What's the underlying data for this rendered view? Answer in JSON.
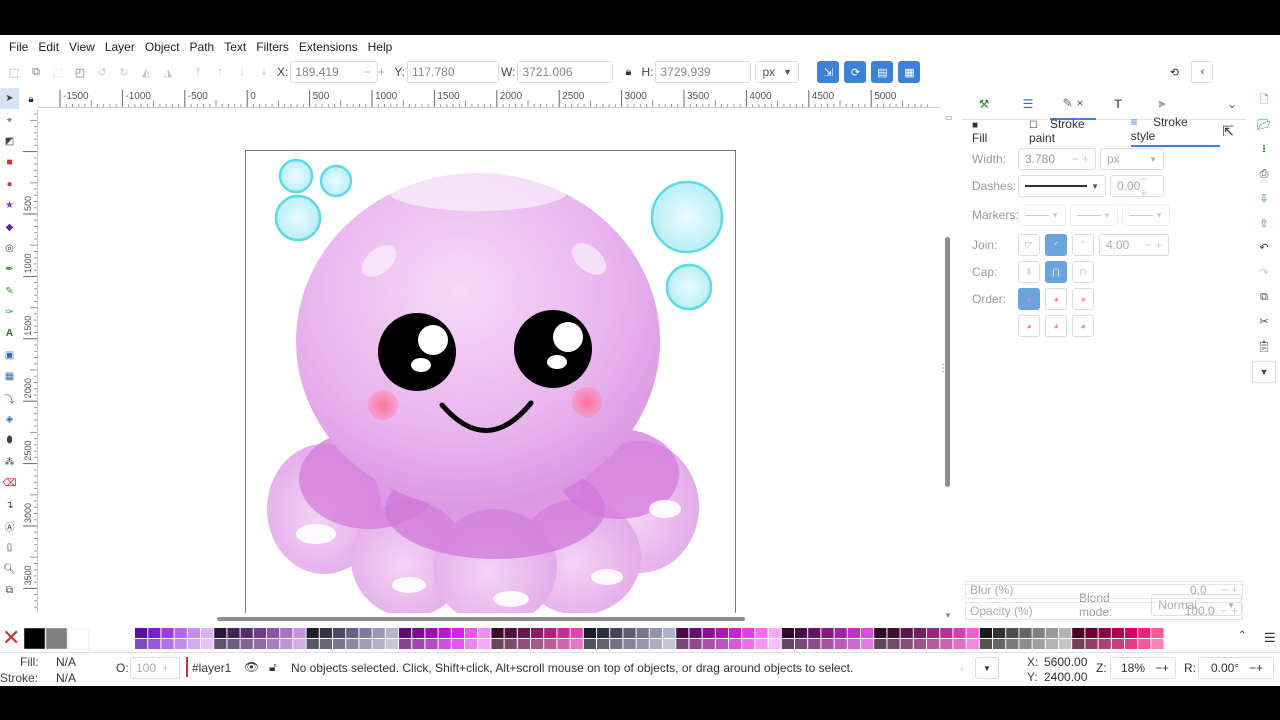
{
  "menu": [
    "File",
    "Edit",
    "View",
    "Layer",
    "Object",
    "Path",
    "Text",
    "Filters",
    "Extensions",
    "Help"
  ],
  "toolbar": {
    "x_label": "X:",
    "x_value": "189.419",
    "y_label": "Y:",
    "y_value": "117.780",
    "w_label": "W:",
    "w_value": "3721.006",
    "h_label": "H:",
    "h_value": "3729.939",
    "unit": "px"
  },
  "ruler_h": [
    "-1500",
    "-1000",
    "-500",
    "0",
    "500",
    "1000",
    "1500",
    "2000",
    "2500",
    "3000",
    "3500",
    "4000",
    "4500",
    "5000"
  ],
  "ruler_v": [
    "500",
    "1000",
    "1500",
    "2000",
    "2500",
    "3000",
    "3500"
  ],
  "dock": {
    "tab_close": "×",
    "subtabs": {
      "fill": "Fill",
      "stroke_paint": "Stroke paint",
      "stroke_style": "Stroke style"
    },
    "width_label": "Width:",
    "width_value": "3.780",
    "width_unit": "px",
    "dashes_label": "Dashes:",
    "dash_offset": "0.00",
    "markers_label": "Markers:",
    "join_label": "Join:",
    "miter_value": "4.00",
    "cap_label": "Cap:",
    "order_label": "Order:",
    "blend_label": "Blend mode:",
    "blend_value": "Normal",
    "blur_label": "Blur (%)",
    "blur_value": "0.0",
    "opacity_label": "Opacity (%)",
    "opacity_value": "100.0"
  },
  "palette_colors": [
    "#000000",
    "#808080",
    "#ffffff",
    "#5a0fa0",
    "#7d1fc8",
    "#9b3de0",
    "#b366e8",
    "#c88cf0",
    "#dbb0f5",
    "#2a1a3a",
    "#3d2452",
    "#552f70",
    "#6e3c8e",
    "#8a52aa",
    "#a870c4",
    "#c491dc",
    "#1f1f2a",
    "#33334a",
    "#4a4a66",
    "#626282",
    "#7c7c9e",
    "#9797b8",
    "#b3b3cf",
    "#5e0a6e",
    "#7a0c8e",
    "#9a10b0",
    "#bb17d0",
    "#d822e8",
    "#e65af0",
    "#f08ff5",
    "#3a0a2a",
    "#52103c",
    "#6d1650",
    "#8a1d66",
    "#a8257e",
    "#c43098",
    "#de45b0",
    "#1a1a2a",
    "#2e2e44",
    "#44445e",
    "#5c5c78",
    "#767692",
    "#9292ac",
    "#b0b0c6",
    "#4a0a4a",
    "#6a0e6a",
    "#8c128c",
    "#ae18ae",
    "#cc22cc",
    "#e040e0",
    "#f070f0",
    "#f8a8f8",
    "#300830",
    "#4a0c4a",
    "#661266",
    "#841a84",
    "#a324a3",
    "#c232c2",
    "#dd4ddd",
    "#2a0a22",
    "#420e36",
    "#5c144c",
    "#781c64",
    "#96267e",
    "#b4329a",
    "#d240b6",
    "#ee60d0",
    "#1a1a1a",
    "#333333",
    "#4d4d4d",
    "#666666",
    "#808080",
    "#999999",
    "#b3b3b3",
    "#4a0022",
    "#6a0030",
    "#8c0040",
    "#b00052",
    "#d40066",
    "#f0207c",
    "#ff5a9a"
  ],
  "status": {
    "fill_label": "Fill:",
    "fill_value": "N/A",
    "stroke_label": "Stroke:",
    "stroke_value": "N/A",
    "opacity_label": "O:",
    "opacity_value": "100",
    "layer": "#layer1",
    "message": "No objects selected. Click, Shift+click, Alt+scroll mouse on top of objects, or drag around objects to select.",
    "cx_label": "X:",
    "cx_value": "5600.00",
    "cy_label": "Y:",
    "cy_value": "2400.00",
    "zoom_label": "Z:",
    "zoom_value": "18%",
    "rot_label": "R:",
    "rot_value": "0.00°"
  }
}
